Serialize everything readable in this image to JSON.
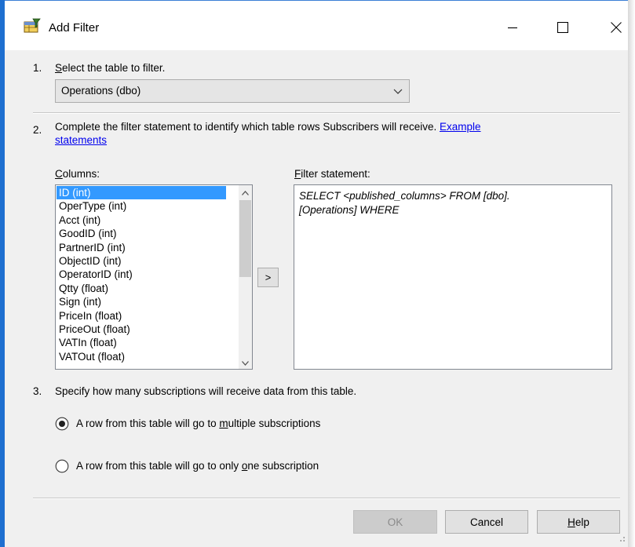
{
  "window": {
    "title": "Add Filter",
    "icon": "add-filter-app-icon",
    "controls": {
      "minimize": "minimize-icon",
      "maximize": "maximize-icon",
      "close": "close-icon"
    }
  },
  "step1": {
    "number": "1.",
    "label_accesskey": "S",
    "label_rest": "elect the table to filter.",
    "table_select_value": "Operations (dbo)"
  },
  "step2": {
    "number": "2.",
    "text": "Complete the filter statement to identify which table rows Subscribers will receive.",
    "link_part1": "Example",
    "link_part2": "statements",
    "columns_label_accesskey": "C",
    "columns_label_rest": "olumns:",
    "columns": [
      "ID (int)",
      "OperType (int)",
      "Acct (int)",
      "GoodID (int)",
      "PartnerID (int)",
      "ObjectID (int)",
      "OperatorID (int)",
      "Qtty (float)",
      "Sign (int)",
      "PriceIn (float)",
      "PriceOut (float)",
      "VATIn (float)",
      "VATOut (float)"
    ],
    "selected_column": "ID (int)",
    "add_button_label": ">",
    "filter_label_accesskey": "F",
    "filter_label_rest": "ilter statement:",
    "filter_line1": "SELECT <published_columns> FROM [dbo].",
    "filter_line2": "[Operations] WHERE"
  },
  "step3": {
    "number": "3.",
    "text": "Specify how many subscriptions will receive data from this table.",
    "option1_pre": "A row from this table will go to ",
    "option1_key": "m",
    "option1_post": "ultiple subscriptions",
    "option1_checked": true,
    "option2_pre": "A row from this table will go to only ",
    "option2_key": "o",
    "option2_post": "ne subscription",
    "option2_checked": false
  },
  "buttons": {
    "ok": "OK",
    "cancel": "Cancel",
    "help_key": "H",
    "help_rest": "elp"
  },
  "colors": {
    "accent": "#1e6fd0",
    "selection": "#3399ff",
    "link": "#0000ee"
  }
}
